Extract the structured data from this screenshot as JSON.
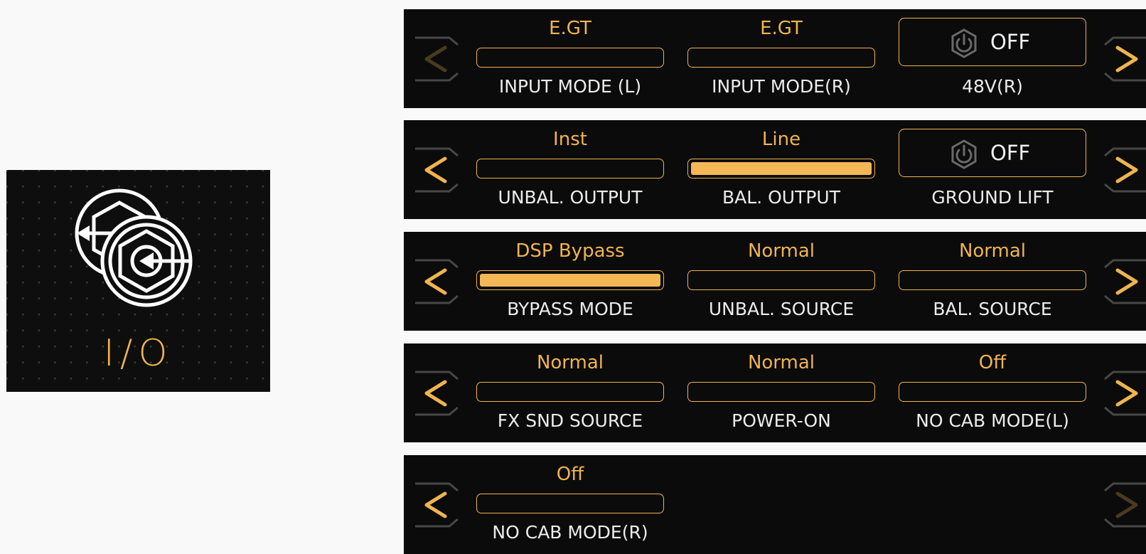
{
  "tile": {
    "icon": "io-jack-icon",
    "title": "I/O"
  },
  "rows": [
    {
      "prev_active": false,
      "next_active": true,
      "cells": [
        {
          "type": "bar",
          "value": "E.GT",
          "label": "INPUT MODE (L)",
          "filled": false
        },
        {
          "type": "bar",
          "value": "E.GT",
          "label": "INPUT MODE(R)",
          "filled": false
        },
        {
          "type": "power",
          "value": "OFF",
          "label": "48V(R)"
        }
      ]
    },
    {
      "prev_active": true,
      "next_active": true,
      "cells": [
        {
          "type": "bar",
          "value": "Inst",
          "label": "UNBAL. OUTPUT",
          "filled": false
        },
        {
          "type": "bar",
          "value": "Line",
          "label": "BAL. OUTPUT",
          "filled": true
        },
        {
          "type": "power",
          "value": "OFF",
          "label": "GROUND LIFT"
        }
      ]
    },
    {
      "prev_active": true,
      "next_active": true,
      "cells": [
        {
          "type": "bar",
          "value": "DSP Bypass",
          "label": "BYPASS MODE",
          "filled": true
        },
        {
          "type": "bar",
          "value": "Normal",
          "label": "UNBAL. SOURCE",
          "filled": false
        },
        {
          "type": "bar",
          "value": "Normal",
          "label": "BAL. SOURCE",
          "filled": false
        }
      ]
    },
    {
      "prev_active": true,
      "next_active": true,
      "cells": [
        {
          "type": "bar",
          "value": "Normal",
          "label": "FX SND SOURCE",
          "filled": false
        },
        {
          "type": "bar",
          "value": "Normal",
          "label": "POWER-ON",
          "filled": false
        },
        {
          "type": "bar",
          "value": "Off",
          "label": "NO CAB MODE(L)",
          "filled": false
        }
      ]
    },
    {
      "prev_active": true,
      "next_active": false,
      "cells": [
        {
          "type": "bar",
          "value": "Off",
          "label": "NO CAB MODE(R)",
          "filled": false
        }
      ]
    }
  ],
  "colors": {
    "accent": "#f0b44f",
    "accent_dim": "#4a3a1f",
    "panel": "#0b0b0b",
    "label": "#ececec",
    "bracket": "#474747",
    "power_icon": "#6a6a6a"
  }
}
